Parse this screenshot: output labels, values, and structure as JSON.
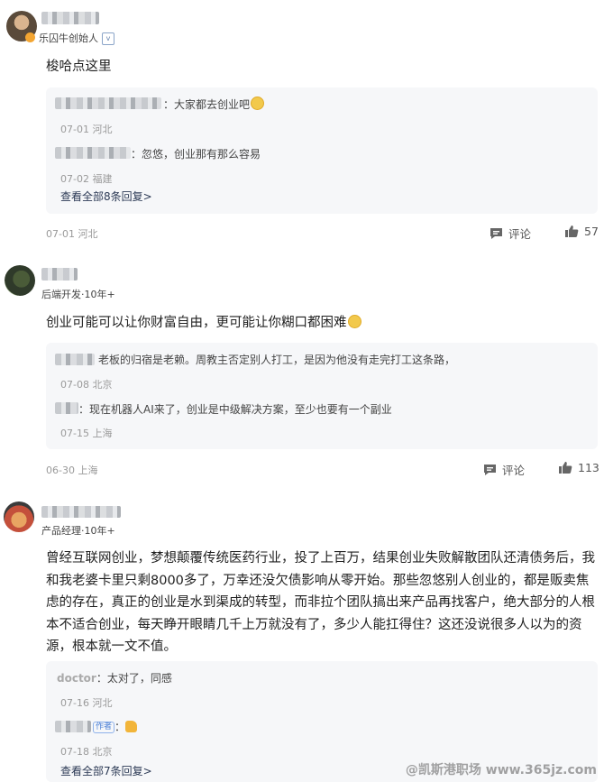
{
  "comments": [
    {
      "subtitle": "乐囚牛创始人",
      "verified_badge": "v",
      "content": "梭哈点这里",
      "replies": [
        {
          "text": "：大家都去创业吧",
          "meta": "07-01 河北",
          "emoji": "grin-emoji"
        },
        {
          "text": "：忽悠，创业那有那么容易",
          "meta": "07-02 福建"
        }
      ],
      "view_all": "查看全部8条回复>",
      "meta": "07-01 河北",
      "comment_label": "评论",
      "likes": "57"
    },
    {
      "subtitle": "后端开发·10年+",
      "content": "创业可能可以让你财富自由，更可能让你糊口都困难",
      "replies": [
        {
          "text": "老板的归宿是老赖。周教主否定别人打工，是因为他没有走完打工这条路，",
          "meta": "07-08 北京"
        },
        {
          "text": "：现在机器人AI来了，创业是中级解决方案，至少也要有一个副业",
          "meta": "07-15 上海"
        }
      ],
      "meta": "06-30 上海",
      "comment_label": "评论",
      "likes": "113"
    },
    {
      "subtitle": "产品经理·10年+",
      "content": "曾经互联网创业，梦想颠覆传统医药行业，投了上百万，结果创业失败解散团队还清债务后，我和我老婆卡里只剩8000多了，万幸还没欠债影响从零开始。那些忽悠别人创业的，都是贩卖焦虑的存在，真正的创业是水到渠成的转型，而非拉个团队搞出来产品再找客户，绝大部分的人根本不适合创业，每天睁开眼睛几千上万就没有了，多少人能扛得住？这还没说很多人以为的资源，根本就一文不值。",
      "replies": [
        {
          "name": "doctor",
          "text": "：太对了，同感",
          "meta": "07-16 河北"
        },
        {
          "author_tag": "作者",
          "text": "：",
          "emoji": "thumbs-up-emoji",
          "meta": "07-18 北京"
        }
      ],
      "view_all": "查看全部7条回复>"
    }
  ],
  "watermark": "@凯斯港职场 www.365jz.com"
}
